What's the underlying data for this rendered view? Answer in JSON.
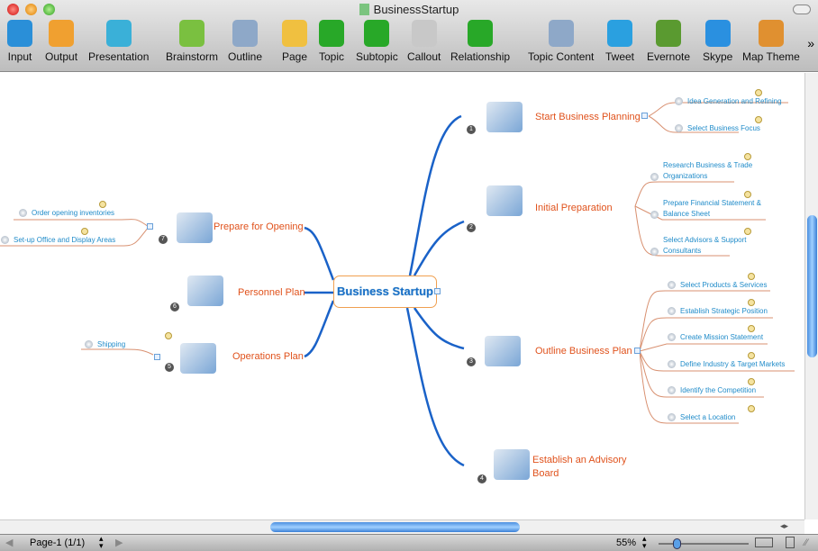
{
  "window": {
    "title": "BusinessStartup"
  },
  "toolbar": [
    {
      "label": "Input",
      "icon": "input-arrow-icon",
      "color": "#2a8fd8"
    },
    {
      "label": "Output",
      "icon": "output-arrow-icon",
      "color": "#f0a030"
    },
    {
      "label": "Presentation",
      "icon": "presentation-icon",
      "color": "#3ab0d8"
    },
    {
      "label": "Brainstorm",
      "icon": "lightbulb-icon",
      "color": "#7ac040"
    },
    {
      "label": "Outline",
      "icon": "outline-icon",
      "color": "#8ea8c8"
    },
    {
      "label": "Page",
      "icon": "page-add-icon",
      "color": "#f0c040"
    },
    {
      "label": "Topic",
      "icon": "topic-add-icon",
      "color": "#28a828"
    },
    {
      "label": "Subtopic",
      "icon": "subtopic-add-icon",
      "color": "#28a828"
    },
    {
      "label": "Callout",
      "icon": "callout-icon",
      "color": "#c8c8c8"
    },
    {
      "label": "Relationship",
      "icon": "relationship-icon",
      "color": "#28a828"
    },
    {
      "label": "Topic Content",
      "icon": "topic-content-icon",
      "color": "#8ea8c8"
    },
    {
      "label": "Tweet",
      "icon": "twitter-bird-icon",
      "color": "#2aa0e0"
    },
    {
      "label": "Evernote",
      "icon": "evernote-icon",
      "color": "#5a9a30"
    },
    {
      "label": "Skype",
      "icon": "skype-icon",
      "color": "#2a90e0"
    },
    {
      "label": "Map Theme",
      "icon": "map-theme-icon",
      "color": "#e09030"
    }
  ],
  "map": {
    "central": "Business Startup",
    "topics": [
      {
        "number": "1",
        "label": "Start Business Planning",
        "subtopics": [
          "Idea Generation and Refining",
          "Select Business Focus"
        ]
      },
      {
        "number": "2",
        "label": "Initial Preparation",
        "subtopics": [
          "Research Business & Trade Organizations",
          "Prepare Financial Statement & Balance Sheet",
          "Select Advisors & Support Consultants"
        ]
      },
      {
        "number": "3",
        "label": "Outline Business Plan",
        "subtopics": [
          "Select Products & Services",
          "Establish Strategic Position",
          "Create Mission Statement",
          "Define Industry & Target Markets",
          "Identify the Competition",
          "Select a Location"
        ]
      },
      {
        "number": "4",
        "label": "Establish an Advisory Board",
        "subtopics": []
      },
      {
        "number": "5",
        "label": "Operations Plan",
        "subtopics": [
          "Shipping"
        ]
      },
      {
        "number": "6",
        "label": "Personnel Plan",
        "subtopics": []
      },
      {
        "number": "7",
        "label": "Prepare for Opening",
        "subtopics": [
          "Order opening inventories",
          "Set-up Office and Display Areas"
        ]
      }
    ]
  },
  "status": {
    "page": "Page-1 (1/1)",
    "zoom": "55%",
    "zoom_level": 0.2
  }
}
